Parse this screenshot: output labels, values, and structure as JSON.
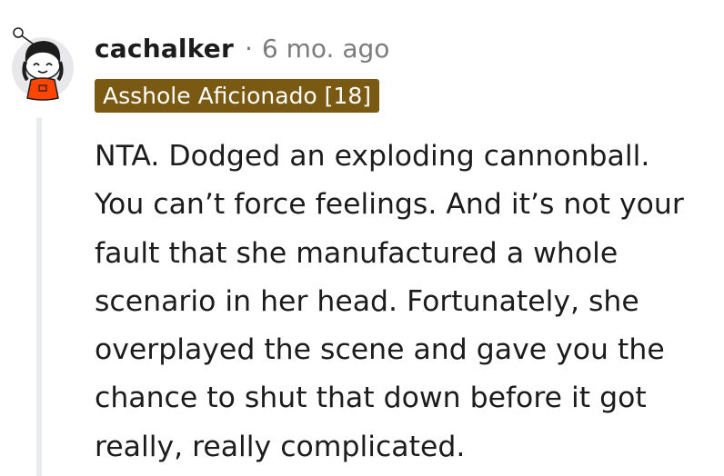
{
  "comment": {
    "username": "cachalker",
    "separator": "·",
    "time": "6 mo. ago",
    "flair": "Asshole Aficionado [18]",
    "flair_color": "#7a5a12",
    "avatar_icon": "snoo-avatar-icon",
    "body_lines": [
      "NTA. Dodged an exploding cannonball.",
      "You can’t force feelings. And it’s not your",
      "fault that she manufactured a whole",
      "scenario in her head. Fortunately, she",
      "overplayed the scene and gave you the",
      "chance to shut that down before it got",
      "really, really complicated."
    ]
  }
}
